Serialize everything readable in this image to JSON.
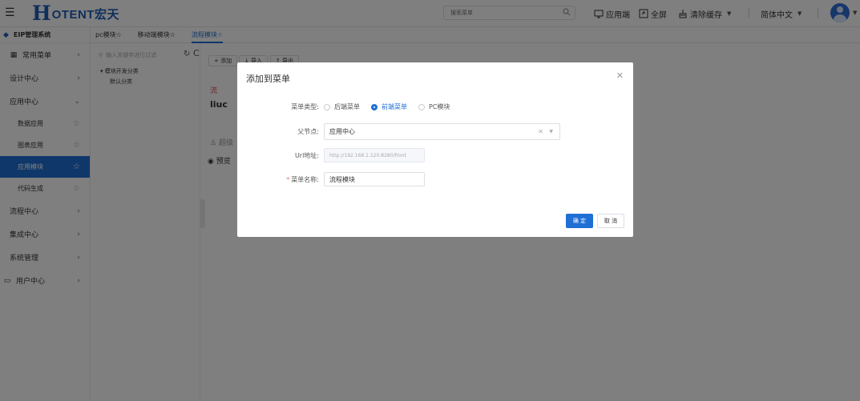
{
  "header": {
    "logo_h": "H",
    "logo_text": "OTENT宏天",
    "search_placeholder": "搜索菜单",
    "app_end": "应用端",
    "fullscreen": "全屏",
    "clear_cache": "清除缓存",
    "language": "简体中文"
  },
  "sidebar": {
    "system_name": "EIP管理系统",
    "items": [
      {
        "label": "常用菜单"
      },
      {
        "label": "设计中心"
      },
      {
        "label": "应用中心"
      },
      {
        "label": "数据应用"
      },
      {
        "label": "图表应用"
      },
      {
        "label": "应用模块"
      },
      {
        "label": "代码生成"
      },
      {
        "label": "流程中心"
      },
      {
        "label": "集成中心"
      },
      {
        "label": "系统管理"
      },
      {
        "label": "用户中心"
      }
    ]
  },
  "tabs": [
    {
      "label": "pc模块☆"
    },
    {
      "label": "移动端模块☆"
    },
    {
      "label": "流程模块☆"
    }
  ],
  "content": {
    "tree_search_placeholder": "输入关键字进行过滤",
    "tree_root": "模块开发分类",
    "tree_child": "默认分类",
    "btn_add": "+ 添加",
    "btn_import": "↓ 导入",
    "btn_export": "↑ 导出",
    "card_red": "流",
    "card_title": "liuc",
    "card_user": "超级",
    "card_preview": "预览"
  },
  "dialog": {
    "title": "添加到菜单",
    "menu_type_label": "菜单类型:",
    "menu_type_options": [
      "后端菜单",
      "前端菜单",
      "PC模块"
    ],
    "parent_label": "父节点:",
    "parent_value": "应用中心",
    "url_label": "Url地址:",
    "url_value": "http://192.168.1.120:8280/front",
    "name_label": "菜单名称:",
    "name_value": "流程模块",
    "confirm": "确 定",
    "cancel": "取 消"
  }
}
